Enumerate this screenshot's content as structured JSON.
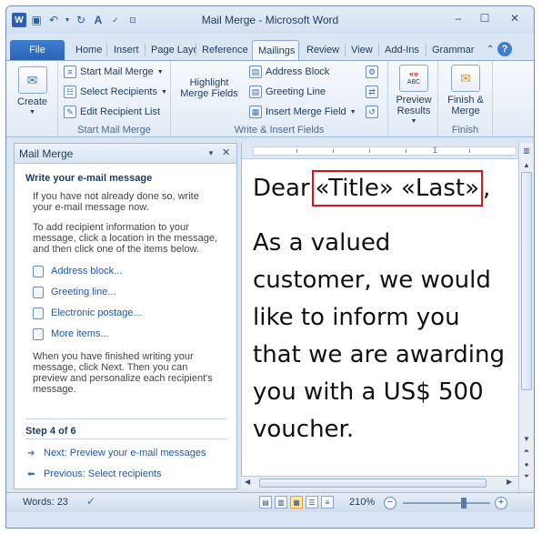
{
  "window": {
    "title": "Mail Merge - Microsoft Word"
  },
  "qat": {
    "word_icon": "word-icon",
    "save_icon": "save-icon",
    "undo_icon": "undo-icon",
    "redo_icon": "redo-icon",
    "format_icon": "font-color-icon",
    "spell_icon": "spelling-icon",
    "customize_icon": "customize-dropdown-icon"
  },
  "window_controls": {
    "minimize": "–",
    "maximize": "☐",
    "close": "✕"
  },
  "tabs": [
    {
      "label": "File"
    },
    {
      "label": "Home"
    },
    {
      "label": "Insert"
    },
    {
      "label": "Page Layo"
    },
    {
      "label": "Reference"
    },
    {
      "label": "Mailings"
    },
    {
      "label": "Review"
    },
    {
      "label": "View"
    },
    {
      "label": "Add-Ins"
    },
    {
      "label": "Grammar"
    }
  ],
  "ribbon": {
    "create": {
      "label": "Create"
    },
    "start_mail_merge": {
      "group_label": "Start Mail Merge",
      "start_label": "Start Mail Merge",
      "select_recipients_label": "Select Recipients",
      "edit_recipient_list_label": "Edit Recipient List"
    },
    "write_insert": {
      "group_label": "Write & Insert Fields",
      "highlight_label_1": "Highlight",
      "highlight_label_2": "Merge Fields",
      "address_block_label": "Address Block",
      "greeting_line_label": "Greeting Line",
      "insert_merge_field_label": "Insert Merge Field"
    },
    "preview": {
      "label_1": "Preview",
      "label_2": "Results",
      "icon_text": "«»",
      "icon_sub": "ABC"
    },
    "finish": {
      "group_label": "Finish",
      "label_1": "Finish &",
      "label_2": "Merge"
    }
  },
  "pane": {
    "title": "Mail Merge",
    "heading": "Write your e-mail message",
    "para1_l1": "If you have not already done so, write",
    "para1_l2": "your e-mail message now.",
    "para2_l1": "To add recipient information to your",
    "para2_l2": "message, click a location in the message,",
    "para2_l3": "and then click one of the items below.",
    "links": [
      "Address block...",
      "Greeting line...",
      "Electronic postage...",
      "More items..."
    ],
    "para3_l1": "When you have finished writing your",
    "para3_l2": "message, click Next. Then you can",
    "para3_l3": "preview and personalize each recipient's",
    "para3_l4": "message.",
    "step": "Step 4 of 6",
    "next": "Next: Preview your e-mail messages",
    "previous": "Previous: Select recipients"
  },
  "document": {
    "dear": "Dear",
    "fields": "«Title» «Last»",
    "comma": ",",
    "body_lines": [
      "As a valued",
      "customer, we would",
      "like to inform you",
      "that we are awarding",
      "you with a US$ 500",
      "voucher."
    ],
    "ruler_mark": "1"
  },
  "statusbar": {
    "words": "Words: 23",
    "zoom": "210%",
    "zoom_level_percent": 210
  }
}
